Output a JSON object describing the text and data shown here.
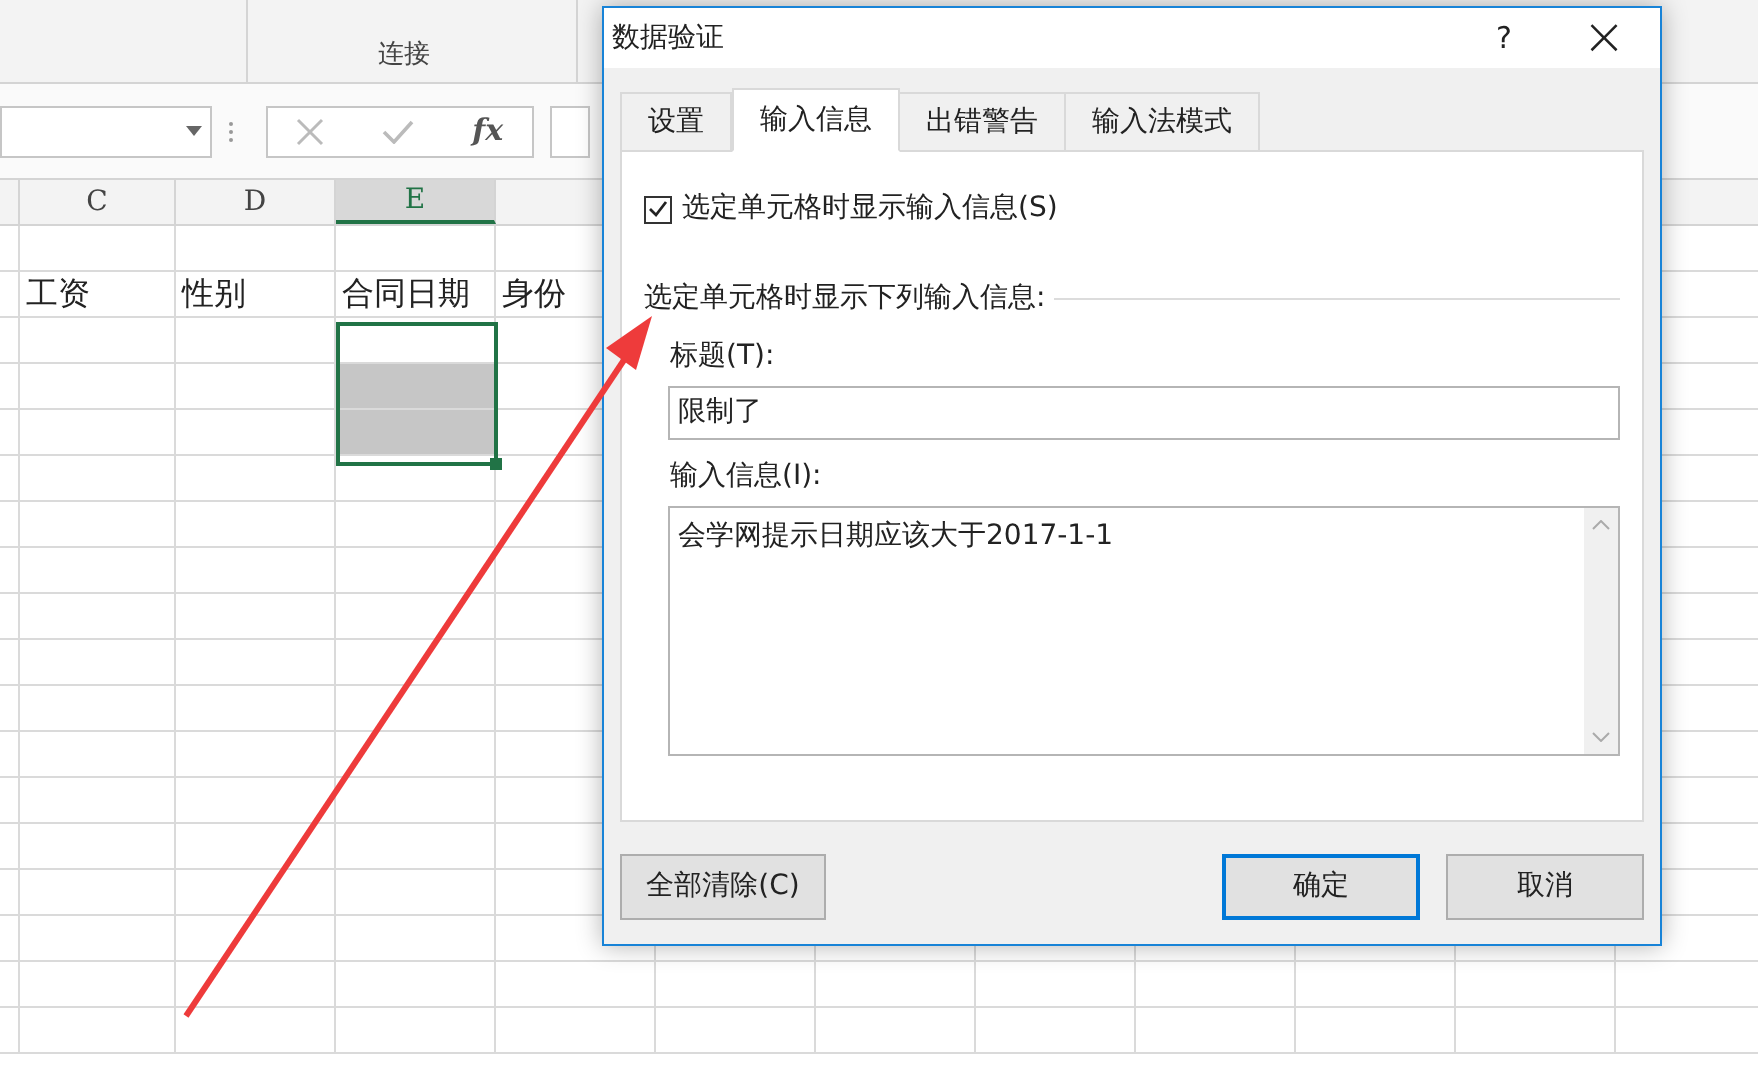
{
  "ribbon": {
    "group_label": "连接"
  },
  "formula_bar": {
    "function_label": "fx"
  },
  "sheet": {
    "columns": [
      {
        "label": "C",
        "selected": false
      },
      {
        "label": "D",
        "selected": false
      },
      {
        "label": "E",
        "selected": true
      }
    ],
    "header_row": [
      "工资",
      "性别",
      "合同日期",
      "身份"
    ]
  },
  "dialog": {
    "title": "数据验证",
    "help": "?",
    "close": "×",
    "tabs": [
      {
        "label": "设置",
        "selected": false
      },
      {
        "label": "输入信息",
        "selected": true
      },
      {
        "label": "出错警告",
        "selected": false
      },
      {
        "label": "输入法模式",
        "selected": false
      }
    ],
    "show_checkbox": {
      "label": "选定单元格时显示输入信息(S)",
      "checked": true
    },
    "group_label": "选定单元格时显示下列输入信息:",
    "title_field": {
      "label": "标题(T):",
      "value": "限制了"
    },
    "message_field": {
      "label": "输入信息(I):",
      "value": "会学网提示日期应该大于2017-1-1"
    },
    "buttons": [
      {
        "label": "全部清除(C)",
        "default": false
      },
      {
        "label": "确定",
        "default": true
      },
      {
        "label": "取消",
        "default": false
      }
    ]
  }
}
